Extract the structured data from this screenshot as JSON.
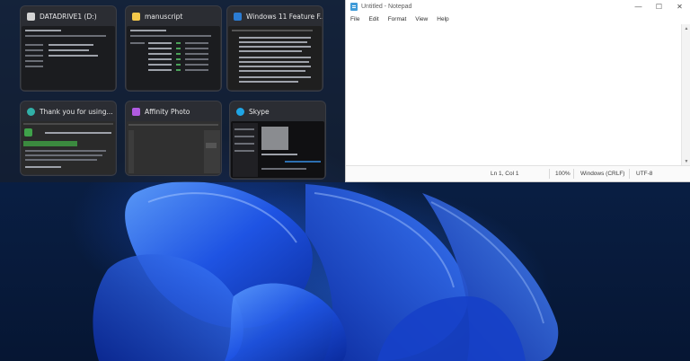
{
  "snap_assist": {
    "windows": [
      {
        "title": "DATADRIVE1 (D:)",
        "icon": "file-explorer-icon",
        "icon_color": "#d4d4d4"
      },
      {
        "title": "manuscript",
        "icon": "folder-icon",
        "icon_color": "#f4c84a"
      },
      {
        "title": "Windows 11 Feature F...",
        "icon": "word-icon",
        "icon_color": "#2b7cd3"
      },
      {
        "title": "Thank you for using...",
        "icon": "edge-icon",
        "icon_color": "#31b0a8"
      },
      {
        "title": "Affinity Photo",
        "icon": "affinity-photo-icon",
        "icon_color": "#b05be0"
      },
      {
        "title": "Skype",
        "icon": "skype-icon",
        "icon_color": "#1fa5e5"
      }
    ]
  },
  "notepad": {
    "title": "Untitled - Notepad",
    "menu": [
      "File",
      "Edit",
      "Format",
      "View",
      "Help"
    ],
    "controls": {
      "minimize": "—",
      "maximize": "☐",
      "close": "✕"
    },
    "status": {
      "position": "Ln 1, Col 1",
      "zoom": "100%",
      "line_endings": "Windows (CRLF)",
      "encoding": "UTF-8"
    }
  }
}
